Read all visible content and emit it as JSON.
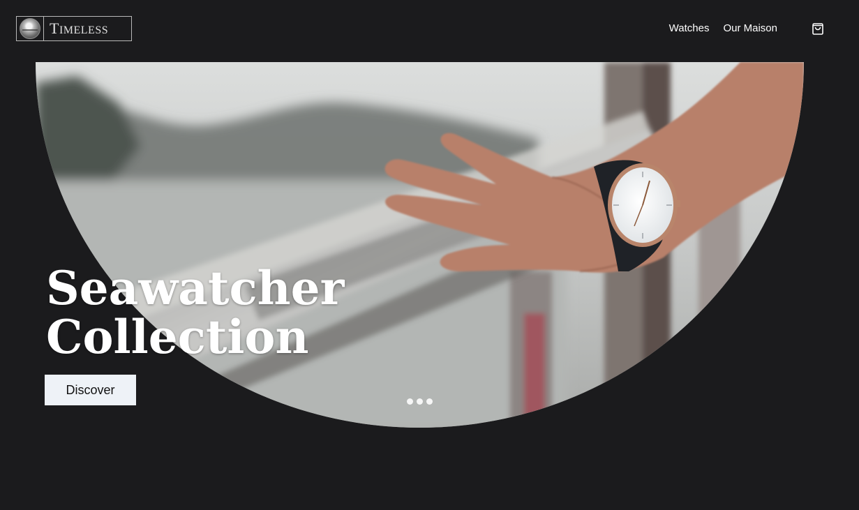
{
  "brand": {
    "name": "Timeless"
  },
  "nav": {
    "links": [
      {
        "label": "Watches"
      },
      {
        "label": "Our Maison"
      }
    ],
    "cart_icon": "shopping-bag-icon"
  },
  "hero": {
    "title_line_1": "Seawatcher",
    "title_line_2": "Collection",
    "cta_label": "Discover",
    "image_description_icon": "wrist-watch-on-railing-photo",
    "slider": {
      "count": 3,
      "active": 1
    }
  },
  "colors": {
    "background": "#1b1b1d",
    "cta_background": "#eef2f7",
    "text": "#ffffff"
  }
}
